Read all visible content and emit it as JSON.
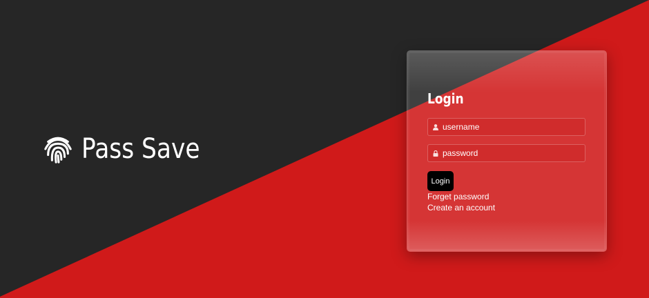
{
  "brand": {
    "name": "Pass Save",
    "icon": "fingerprint-icon"
  },
  "login_card": {
    "title": "Login",
    "username": {
      "placeholder": "username",
      "value": "",
      "icon": "user-icon"
    },
    "password": {
      "placeholder": "password",
      "value": "",
      "icon": "lock-icon"
    },
    "submit_label": "Login",
    "forget_password_label": "Forget password",
    "create_account_label": "Create an account"
  },
  "colors": {
    "dark_background": "#262626",
    "red_background": "#d01a1a",
    "button_background": "#000000",
    "text": "#ffffff"
  }
}
